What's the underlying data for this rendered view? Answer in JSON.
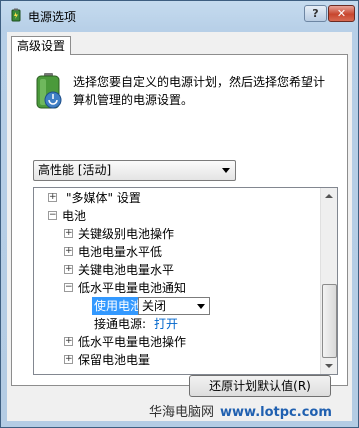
{
  "window": {
    "title": "电源选项"
  },
  "titlebar": {
    "help": "?",
    "close": "✕"
  },
  "tab": {
    "label": "高级设置"
  },
  "description": "选择您要自定义的电源计划，然后选择您希望计算机管理的电源设置。",
  "plan_select": {
    "value": "高性能 [活动]"
  },
  "tree": {
    "multimedia": "\"多媒体\" 设置",
    "battery": "电池",
    "critical_action": "关键级别电池操作",
    "low_level": "电池电量水平低",
    "critical_level": "关键电池电量水平",
    "low_notify": "低水平电量电池通知",
    "on_battery_label": "使用电池:",
    "on_battery_value": "关闭",
    "plugged_in_label": "接通电源:",
    "plugged_in_value": "打开",
    "low_action": "低水平电量电池操作",
    "reserve_level": "保留电池电量"
  },
  "buttons": {
    "restore": "还原计划默认值(R)"
  },
  "watermark": {
    "site": "华海电脑网",
    "url": "www.lotpc.com"
  }
}
